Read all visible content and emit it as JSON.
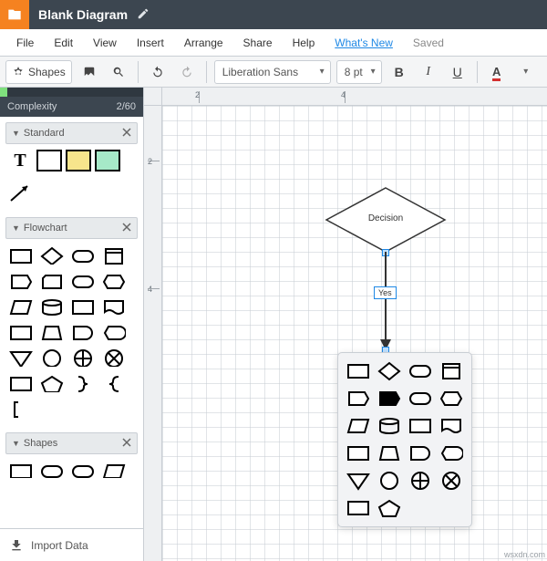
{
  "titlebar": {
    "doc_title": "Blank Diagram"
  },
  "menus": [
    "File",
    "Edit",
    "View",
    "Insert",
    "Arrange",
    "Share",
    "Help",
    "What's New",
    "Saved"
  ],
  "toolbar": {
    "shapes_label": "Shapes",
    "font": "Liberation Sans",
    "font_size": "8 pt",
    "bold": "B",
    "italic": "I",
    "underline": "U",
    "color": "A"
  },
  "complexity": {
    "label": "Complexity",
    "value": "2/60"
  },
  "panels": {
    "standard": {
      "title": "Standard"
    },
    "flowchart": {
      "title": "Flowchart"
    },
    "shapes": {
      "title": "Shapes"
    }
  },
  "import": {
    "label": "Import Data"
  },
  "canvas": {
    "decision_label": "Decision",
    "edge_label": "Yes"
  },
  "ruler": {
    "top1": "2",
    "top2": "4",
    "left1": "2",
    "left2": "4"
  },
  "watermark": "wsxdn.com"
}
